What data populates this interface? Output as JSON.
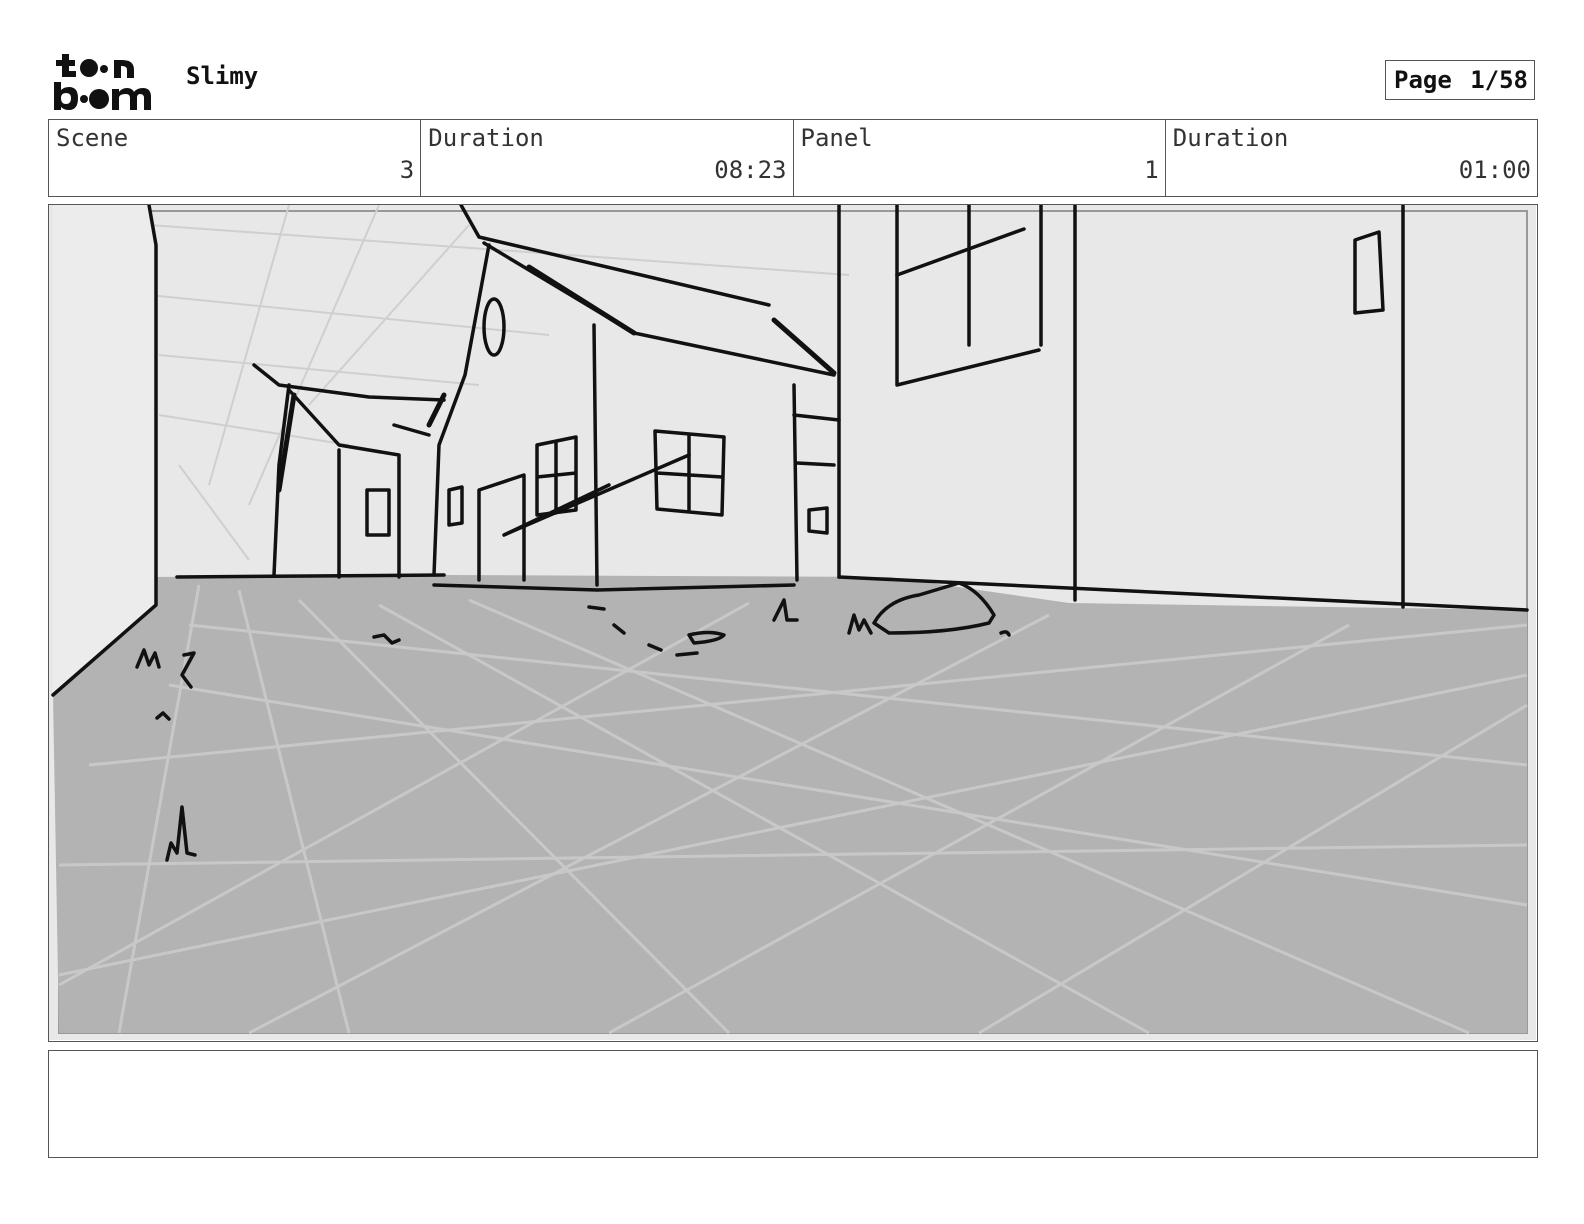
{
  "header": {
    "logo_text": "toon boom",
    "project_title": "Slimy",
    "page_label": "Page",
    "page_number": "1/58"
  },
  "info": {
    "scene_label": "Scene",
    "scene_value": "3",
    "scene_duration_label": "Duration",
    "scene_duration_value": "08:23",
    "panel_label": "Panel",
    "panel_value": "1",
    "panel_duration_label": "Duration",
    "panel_duration_value": "01:00"
  },
  "notes": {
    "text": ""
  }
}
